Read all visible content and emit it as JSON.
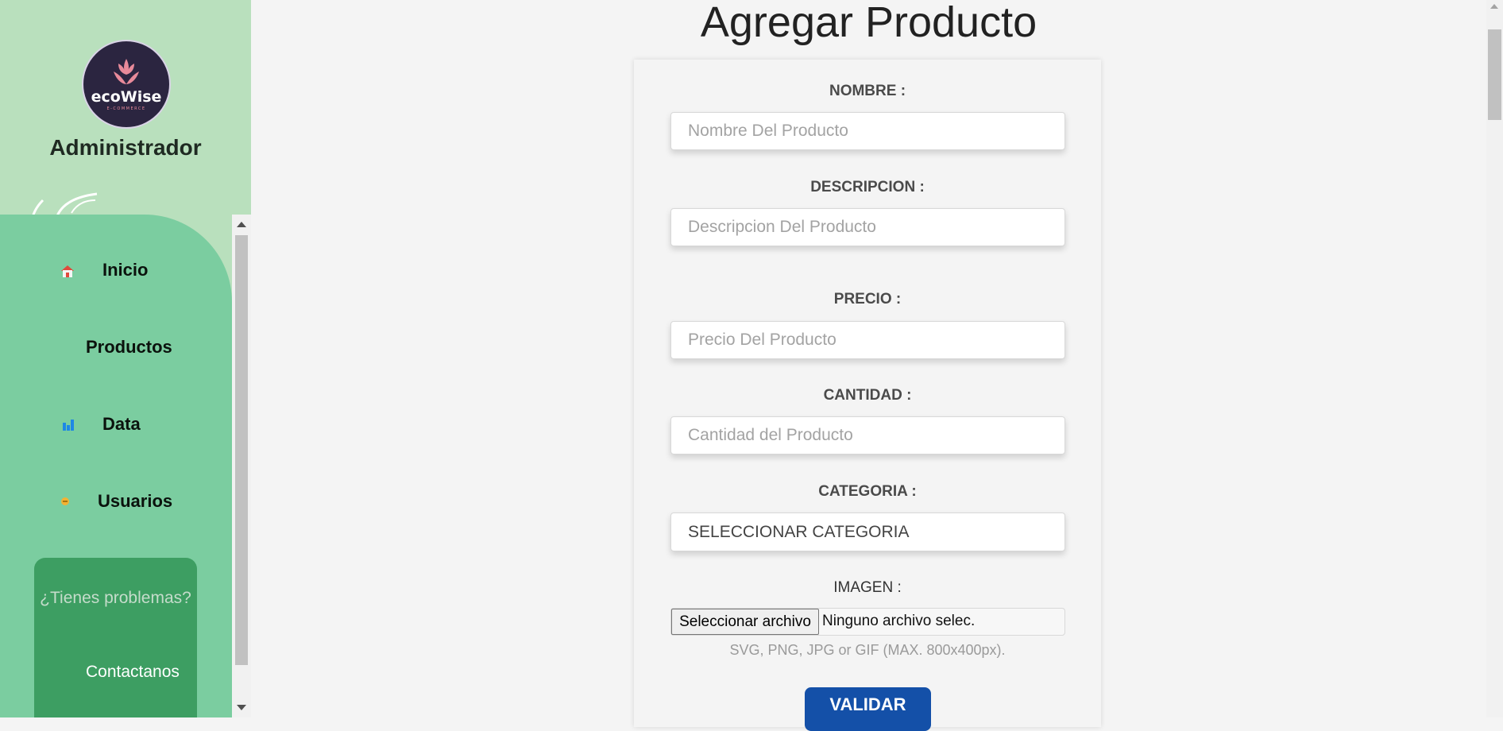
{
  "sidebar": {
    "brand": "ecoWise",
    "brand_sub": "E-COMMERCE",
    "role_title": "Administrador",
    "items": [
      {
        "label": "Inicio",
        "icon": "house-icon"
      },
      {
        "label": "Productos",
        "icon": ""
      },
      {
        "label": "Data",
        "icon": "bar-chart-icon"
      },
      {
        "label": "Usuarios",
        "icon": "user-icon"
      }
    ],
    "help": {
      "question": "¿Tienes problemas?",
      "link": "Contactanos"
    }
  },
  "form": {
    "title": "Agregar Producto",
    "nombre": {
      "label": "NOMBRE :",
      "placeholder": "Nombre Del Producto",
      "value": ""
    },
    "descripcion": {
      "label": "DESCRIPCION :",
      "placeholder": "Descripcion Del Producto",
      "value": ""
    },
    "precio": {
      "label": "PRECIO :",
      "placeholder": "Precio Del Producto",
      "value": ""
    },
    "cantidad": {
      "label": "CANTIDAD :",
      "placeholder": "Cantidad del Producto",
      "value": ""
    },
    "categoria": {
      "label": "CATEGORIA :",
      "selected": "SELECCIONAR CATEGORIA"
    },
    "imagen": {
      "label": "IMAGEN :",
      "button": "Seleccionar archivo",
      "status": "Ninguno archivo selec.",
      "hint": "SVG, PNG, JPG or GIF (MAX. 800x400px)."
    },
    "submit": "VALIDAR"
  },
  "colors": {
    "sidebar_bg": "#b9e0bd",
    "menu_bg": "#7bcda0",
    "help_bg": "#3d9e62",
    "button_bg": "#1450a8"
  }
}
